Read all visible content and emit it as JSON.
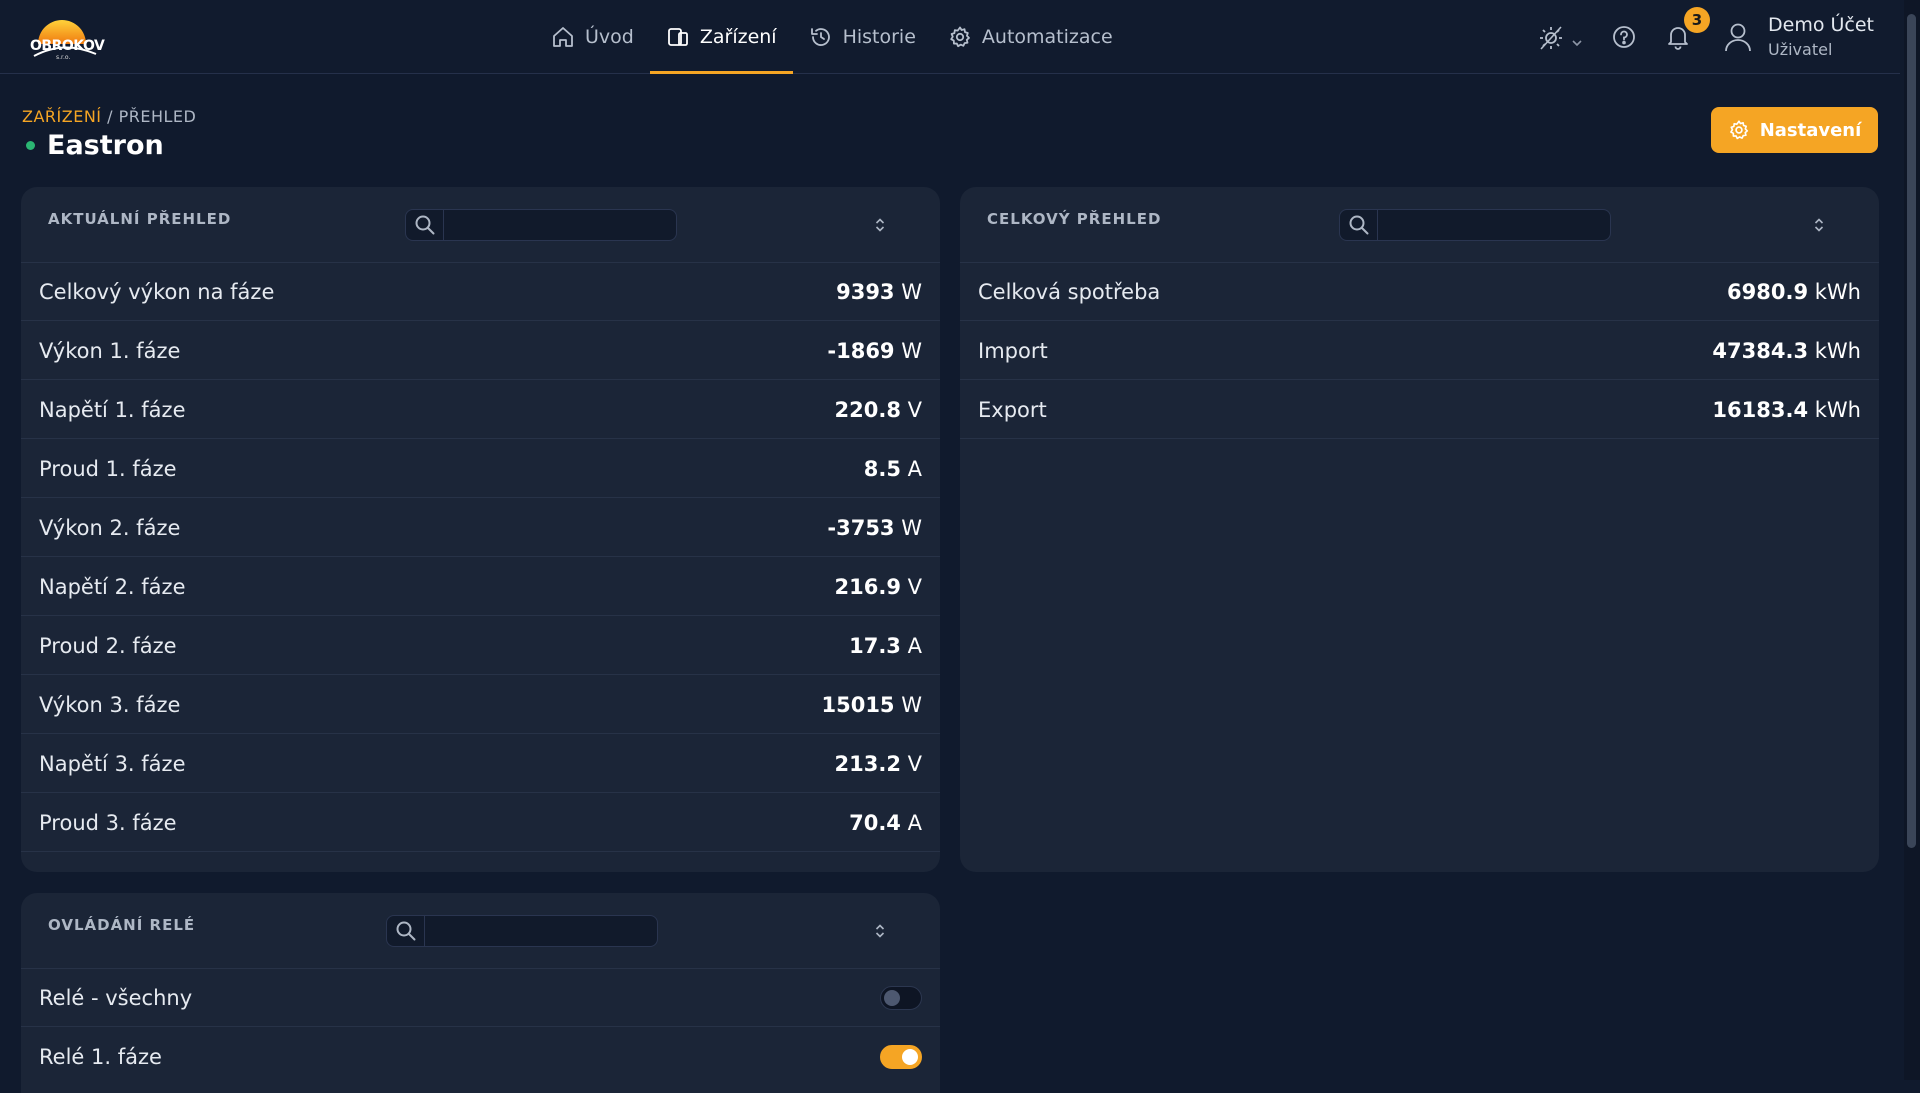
{
  "brand": {
    "logo_text": "OBROKOV",
    "logo_sub": "s.r.o."
  },
  "nav": [
    {
      "label": "Úvod",
      "icon": "home-icon"
    },
    {
      "label": "Zařízení",
      "icon": "devices-icon",
      "active": true
    },
    {
      "label": "Historie",
      "icon": "history-icon"
    },
    {
      "label": "Automatizace",
      "icon": "gear-icon"
    }
  ],
  "topbar": {
    "notifications_count": "3",
    "user_name": "Demo Účet",
    "user_role": "Uživatel"
  },
  "breadcrumb": {
    "section": "ZAŘÍZENÍ",
    "separator": " / ",
    "page": "PŘEHLED"
  },
  "page": {
    "title": "Eastron",
    "settings_label": "Nastavení"
  },
  "current_overview": {
    "title": "AKTUÁLNÍ PŘEHLED",
    "search_placeholder": "",
    "rows": [
      {
        "label": "Celkový výkon na fáze",
        "value": "9393",
        "unit": "W"
      },
      {
        "label": "Výkon 1. fáze",
        "value": "-1869",
        "unit": "W"
      },
      {
        "label": "Napětí 1. fáze",
        "value": "220.8",
        "unit": "V"
      },
      {
        "label": "Proud 1. fáze",
        "value": "8.5",
        "unit": "A"
      },
      {
        "label": "Výkon 2. fáze",
        "value": "-3753",
        "unit": "W"
      },
      {
        "label": "Napětí 2. fáze",
        "value": "216.9",
        "unit": "V"
      },
      {
        "label": "Proud 2. fáze",
        "value": "17.3",
        "unit": "A"
      },
      {
        "label": "Výkon 3. fáze",
        "value": "15015",
        "unit": "W"
      },
      {
        "label": "Napětí 3. fáze",
        "value": "213.2",
        "unit": "V"
      },
      {
        "label": "Proud 3. fáze",
        "value": "70.4",
        "unit": "A"
      }
    ]
  },
  "total_overview": {
    "title": "CELKOVÝ PŘEHLED",
    "search_placeholder": "",
    "rows": [
      {
        "label": "Celková spotřeba",
        "value": "6980.9",
        "unit": "kWh"
      },
      {
        "label": "Import",
        "value": "47384.3",
        "unit": "kWh"
      },
      {
        "label": "Export",
        "value": "16183.4",
        "unit": "kWh"
      }
    ]
  },
  "relay_control": {
    "title": "OVLÁDÁNÍ RELÉ",
    "search_placeholder": "",
    "rows": [
      {
        "label": "Relé - všechny",
        "on": false
      },
      {
        "label": "Relé 1. fáze",
        "on": true
      }
    ]
  },
  "colors": {
    "accent": "#f5a524",
    "background": "#101a2d",
    "card": "#1b2537",
    "status_online": "#2bb673"
  }
}
